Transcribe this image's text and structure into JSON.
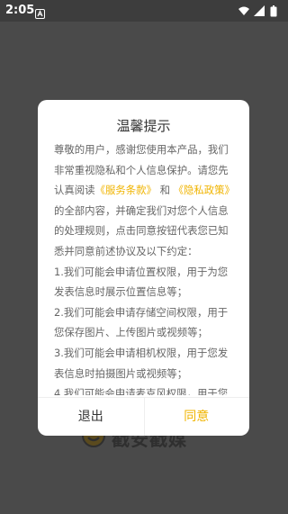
{
  "status_bar": {
    "time": "2:05",
    "icons": [
      "app-notification-icon",
      "wifi-icon",
      "signal-icon",
      "battery-icon"
    ]
  },
  "background": {
    "logo_text": "戳安戳媒"
  },
  "dialog": {
    "title": "温馨提示",
    "intro_1": "尊敬的用户，感谢您使用本产品，我们非常重视隐私和个人信息保护。请您先认真阅读",
    "service_link": "《服务条款》",
    "and": "和",
    "privacy_link": "《隐私政策》",
    "intro_2": "的全部内容，并确定我们对您个人信息的处理规则，点击同意按钮代表您已知悉并同意前述协议及以下约定：",
    "items": [
      "1.我们可能会申请位置权限，用于为您发表信息时展示位置信息等；",
      "2.我们可能会申请存储空间权限，用于您保存图片、上传图片或视频等；",
      "3.我们可能会申请相机权限，用于您发表信息时拍摄图片或视频等；",
      "4.我们可能会申请麦克风权限，用于您"
    ],
    "exit_label": "退出",
    "agree_label": "同意"
  },
  "colors": {
    "accent": "#f0b400",
    "overlay": "#4a4a4a",
    "body_text": "#666666"
  }
}
